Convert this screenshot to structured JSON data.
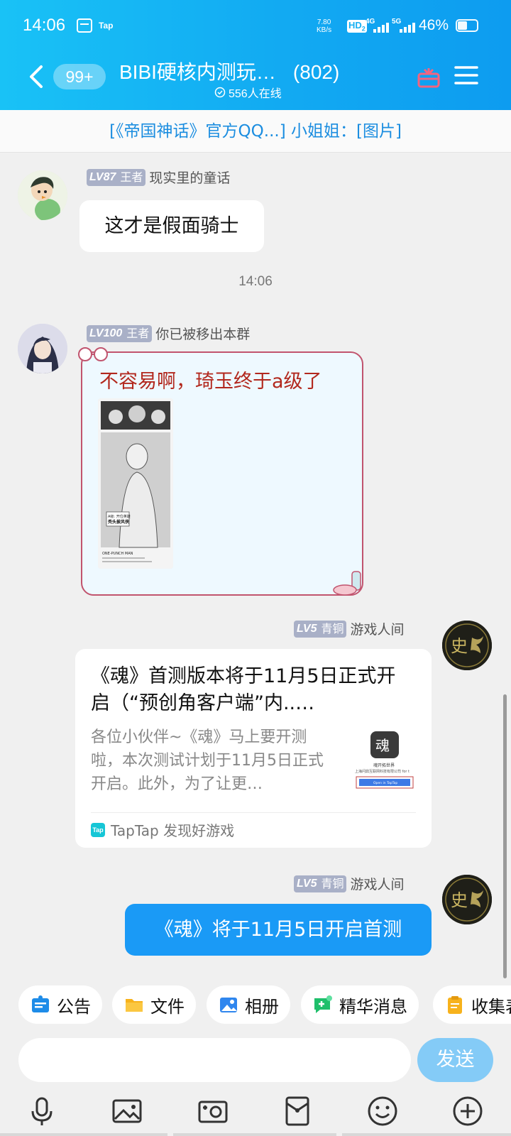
{
  "status_bar": {
    "time": "14:06",
    "tap_label": "Tap",
    "net_speed_value": "7.80",
    "net_speed_unit": "KB/s",
    "hd_label": "HD",
    "hd_sub": "2",
    "network_1": "4G",
    "network_2": "5G",
    "battery_percent": "46%",
    "battery_level": 0.46
  },
  "header": {
    "unread_badge": "99+",
    "group_name": "BIBI硬核内测玩…",
    "member_count": "(802)",
    "online_status": "556人在线"
  },
  "notice_bar": {
    "text": "[《帝国神话》官方QQ...] 小姐姐：[图片]"
  },
  "messages": [
    {
      "level": "LV87",
      "rank": "王者",
      "name": "现实里的童话",
      "text": "这才是假面骑士"
    },
    {
      "timestamp": "14:06"
    },
    {
      "level": "LV100",
      "rank": "王者",
      "name": "你已被移出本群",
      "text": "不容易啊，琦玉终于a级了",
      "image_caption_1": "A级: 开位英雄",
      "image_caption_2": "秃头披风侠",
      "image_footer": "ONE-PUNCH MAN"
    },
    {
      "level": "LV5",
      "rank": "青铜",
      "name": "游戏人间",
      "card_title": "《魂》首测版本将于11月5日正式开启（“预创角客户端”内..…",
      "card_desc": "各位小伙伴~《魂》马上要开测啦，本次测试计划于11月5日正式开启。此外，为了让更…",
      "card_source": "TapTap 发现好游戏",
      "card_thumb_logo": "魂",
      "card_thumb_line_1": "魂开拓世界",
      "card_thumb_line_2": "上海问鼎互联网科技有限公司 for t",
      "card_thumb_button": "Open in TapTap",
      "avatar_char": "史"
    },
    {
      "level": "LV5",
      "rank": "青铜",
      "name": "游戏人间",
      "text": "《魂》将于11月5日开启首测",
      "avatar_char": "史"
    }
  ],
  "quick_actions": [
    {
      "label": "公告",
      "icon": "announcement-icon"
    },
    {
      "label": "文件",
      "icon": "folder-icon"
    },
    {
      "label": "相册",
      "icon": "album-icon"
    },
    {
      "label": "精华消息",
      "icon": "featured-message-icon"
    },
    {
      "label": "收集表",
      "icon": "clipboard-icon"
    }
  ],
  "composer": {
    "placeholder": "",
    "send_label": "发送"
  },
  "toolbar": [
    "microphone-icon",
    "image-icon",
    "camera-icon",
    "red-packet-icon",
    "emoji-icon",
    "plus-icon"
  ],
  "colors": {
    "header_gradient_start": "#19c2f6",
    "header_gradient_end": "#0d9cf0",
    "my_bubble": "#1a9af6",
    "notice_text": "#1b8de0",
    "fancy_text": "#b2281d",
    "level_badge": "#a9b0c7"
  }
}
